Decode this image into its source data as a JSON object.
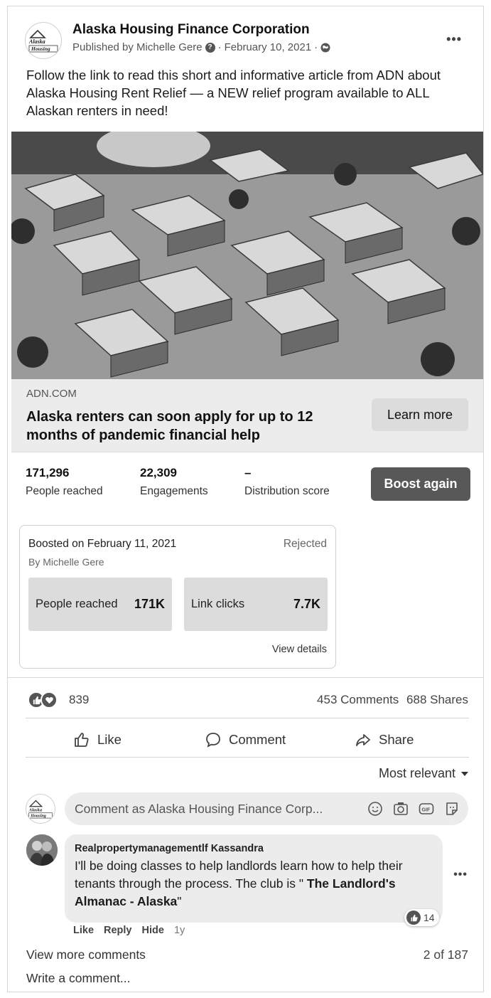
{
  "post": {
    "page_name": "Alaska Housing Finance Corporation",
    "published_by": "Published by Michelle Gere",
    "date": "February 10, 2021",
    "text": "Follow the link to read this short and informative article from ADN about Alaska Housing Rent Relief — a NEW relief program available to ALL Alaskan renters in need!",
    "logo_text_line1": "Alaska",
    "logo_text_line2": "Housing"
  },
  "link": {
    "domain": "ADN.COM",
    "title": "Alaska renters can soon apply for up to 12 months of pandemic financial help",
    "cta": "Learn more"
  },
  "stats": {
    "reached_value": "171,296",
    "reached_label": "People reached",
    "engagements_value": "22,309",
    "engagements_label": "Engagements",
    "distribution_value": "–",
    "distribution_label": "Distribution score",
    "boost_button": "Boost again"
  },
  "boost": {
    "date": "Boosted on February 11, 2021",
    "status": "Rejected",
    "by": "By Michelle Gere",
    "tile1_label": "People reached",
    "tile1_value": "171K",
    "tile2_label": "Link clicks",
    "tile2_value": "7.7K",
    "view_details": "View details"
  },
  "reactions": {
    "count": "839",
    "comments": "453 Comments",
    "shares": "688 Shares"
  },
  "actions": {
    "like": "Like",
    "comment": "Comment",
    "share": "Share"
  },
  "comments": {
    "sort_label": "Most relevant",
    "input_placeholder": "Comment as Alaska Housing Finance Corp...",
    "items": [
      {
        "author": "Realpropertymanagementlf Kassandra",
        "text_main": "I'll be doing classes to help landlords learn how to help their tenants through the process. The club is \" ",
        "text_bold": "The Landlord's Almanac - Alaska",
        "text_end": "\"",
        "reaction_count": "14",
        "like": "Like",
        "reply": "Reply",
        "hide": "Hide",
        "time": "1y"
      }
    ],
    "view_more": "View more comments",
    "page_count": "2 of 187",
    "write_placeholder": "Write a comment..."
  },
  "colors": {
    "button_dark": "#585858",
    "link_box_bg": "#ececec",
    "tile_bg": "#dcdcdc"
  }
}
